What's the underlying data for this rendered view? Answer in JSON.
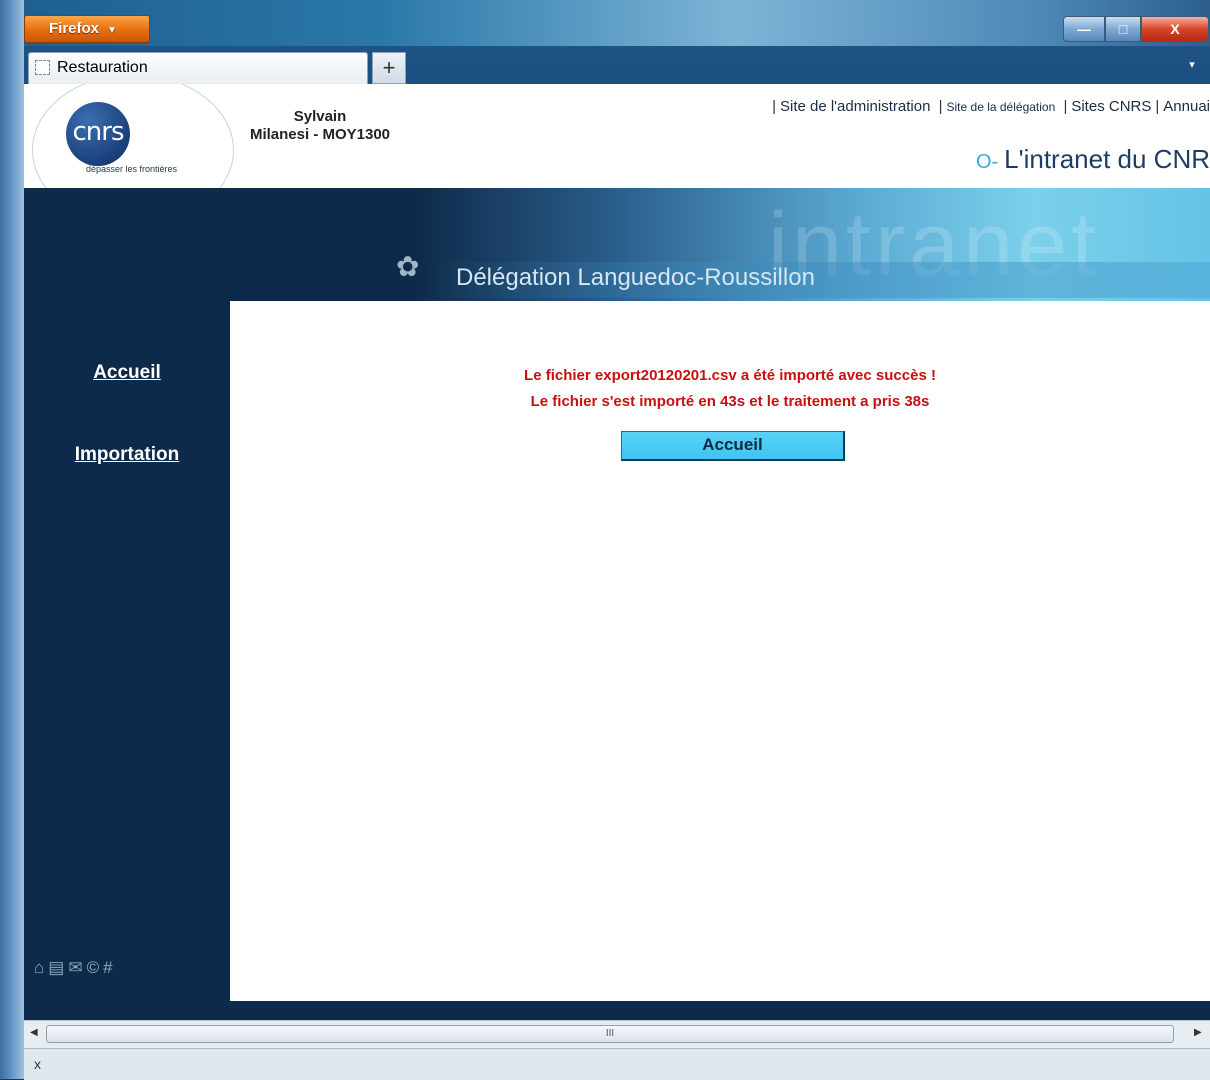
{
  "browser": {
    "menu_button": "Firefox",
    "tab_title": "Restauration",
    "new_tab": "+",
    "minimize": "—",
    "maximize": "□",
    "close": "X",
    "tablist_arrow": "▾"
  },
  "header": {
    "user_first": "Sylvain",
    "user_last": "Milanesi - MOY1300",
    "logo_text": "cnrs",
    "logo_tagline": "dépasser les frontières",
    "links": [
      {
        "label": "Site de l'administration"
      },
      {
        "label": "Site de la délégation"
      },
      {
        "label": "Sites CNRS"
      },
      {
        "label": "Annuai"
      }
    ],
    "intranet_title": "L'intranet du CNR",
    "banner_word": "intranet",
    "delegation_title": "Délégation Languedoc-Roussillon"
  },
  "sidebar": {
    "items": [
      {
        "label": "Accueil"
      },
      {
        "label": "Importation"
      }
    ],
    "footer_icons": [
      "home-icon",
      "printer-icon",
      "mail-icon",
      "copyright-icon",
      "hash-icon"
    ]
  },
  "main": {
    "message_line1": "Le fichier export20120201.csv a été importé avec succès !",
    "message_line2": "Le fichier s'est importé en 43s et le traitement a pris 38s",
    "button_label": "Accueil"
  },
  "scrollbar": {
    "thumb_grip": "III"
  },
  "statusbar": {
    "close_label": "x"
  }
}
